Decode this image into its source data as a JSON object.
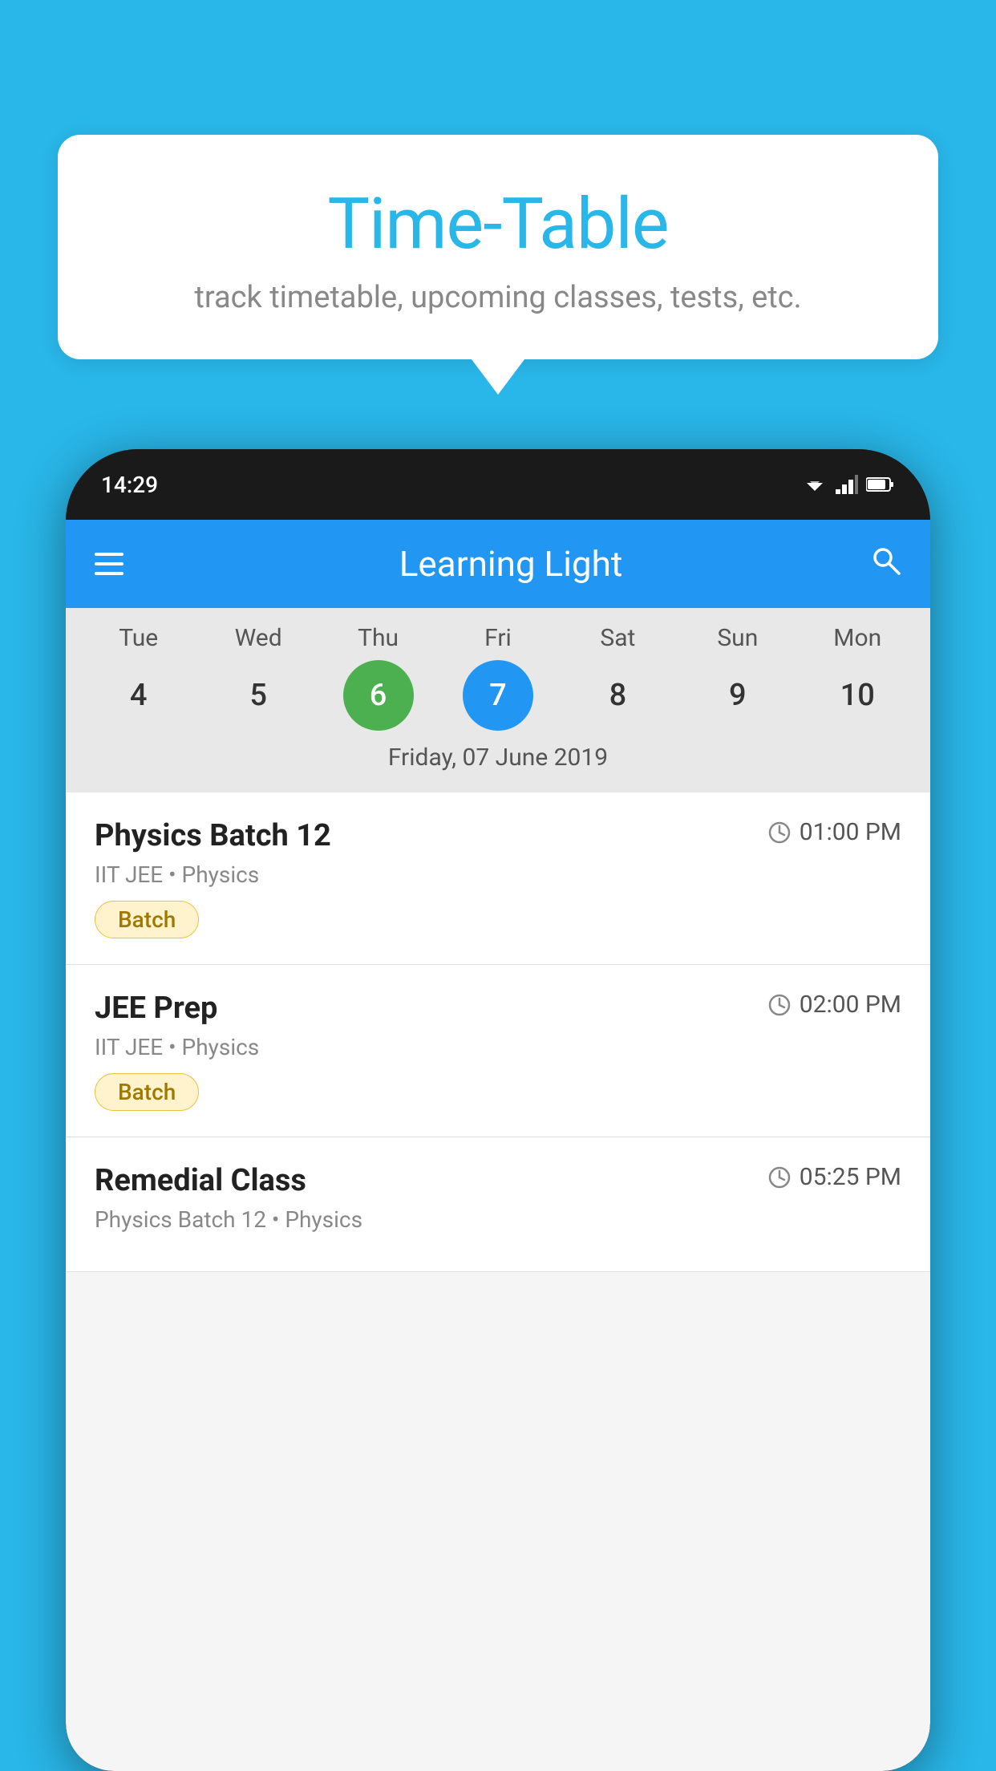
{
  "background_color": "#29b6e8",
  "tooltip": {
    "title": "Time-Table",
    "subtitle": "track timetable, upcoming classes, tests, etc."
  },
  "phone": {
    "status_bar": {
      "time": "14:29"
    },
    "app_bar": {
      "title": "Learning Light",
      "menu_icon": "hamburger-icon",
      "search_icon": "search-icon"
    },
    "calendar": {
      "days": [
        "Tue",
        "Wed",
        "Thu",
        "Fri",
        "Sat",
        "Sun",
        "Mon"
      ],
      "dates": [
        "4",
        "5",
        "6",
        "7",
        "8",
        "9",
        "10"
      ],
      "today_index": 2,
      "selected_index": 3,
      "selected_label": "Friday, 07 June 2019"
    },
    "schedule": [
      {
        "title": "Physics Batch 12",
        "time": "01:00 PM",
        "sub": "IIT JEE • Physics",
        "badge": "Batch"
      },
      {
        "title": "JEE Prep",
        "time": "02:00 PM",
        "sub": "IIT JEE • Physics",
        "badge": "Batch"
      },
      {
        "title": "Remedial Class",
        "time": "05:25 PM",
        "sub": "Physics Batch 12 • Physics",
        "badge": ""
      }
    ]
  }
}
